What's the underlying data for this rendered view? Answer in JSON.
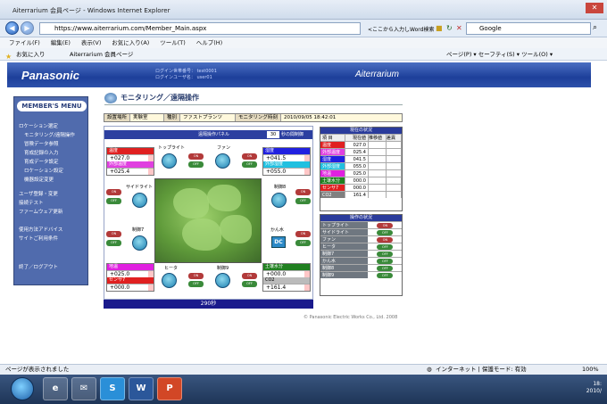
{
  "browser": {
    "title": "Aiterrarium 会員ページ - Windows Internet Explorer",
    "url": "https://www.aiterrarium.com/Member_Main.aspx",
    "search_placeholder": "Google",
    "search_scope": "<ここから入力しWord検索",
    "menus": [
      "ファイル(F)",
      "編集(E)",
      "表示(V)",
      "お気に入り(A)",
      "ツール(T)",
      "ヘルプ(H)"
    ],
    "favorites_label": "お気に入り",
    "tab_label": "Aiterrarium 会員ページ",
    "toolbar_right": "ページ(P) ▾  セーフティ(S) ▾  ツール(O) ▾",
    "status_left": "ページが表示されました",
    "status_zone": "インターネット | 保護モード: 有効",
    "zoom": "100%"
  },
  "site": {
    "brand": "Panasonic",
    "login_line1": "ログイン世帯番号：  test0001",
    "login_line2": "ログインユーザ名：  user01",
    "product_logo": "Aiterrarium"
  },
  "menu": {
    "title": "MEMBER'S MENU",
    "items": [
      "ロケーション選定",
      "モニタリング/遠隔操作",
      "冒険データ参照",
      "育成記録の入力",
      "育成データ設定",
      "ロケーション設定",
      "機器設定変更",
      "ユーザ登録・変更",
      "接続テスト",
      "ファームウェア更新",
      "使用方法アドバイス",
      "サイトご利用条件",
      "終了／ログアウト"
    ]
  },
  "page": {
    "title": "モニタリング／遠隔操作",
    "location_label": "設置場所",
    "location_value": "実験室",
    "type_label": "種別",
    "type_value": "ファストプランツ",
    "time_label": "モニタリング時刻",
    "time_value": "2010/09/05  18:42:01",
    "copyright": "© Panasonic Electric Works Co., Ltd. 2008"
  },
  "panel": {
    "header": "遠隔操作パネル",
    "interval_value": "30",
    "interval_unit": "秒の間制御",
    "timer": "290秒",
    "on_label": "ON",
    "off_label": "OFF",
    "dc_label": "DC",
    "temp": {
      "label": "温度",
      "value": "+027.0"
    },
    "ext_temp": {
      "label": "外部温度",
      "value": "+025.4"
    },
    "humidity": {
      "label": "湿度",
      "value": "+041.5"
    },
    "ext_humidity": {
      "label": "外部湿度",
      "value": "+055.0"
    },
    "soil_temp": {
      "label": "地温",
      "value": "+025.0"
    },
    "sensor": {
      "label": "センサ7",
      "value": "+000.0"
    },
    "soil_water": {
      "label": "土壌水分",
      "value": "+000.0"
    },
    "co2": {
      "label": "CO2",
      "value": "+161.4"
    },
    "devices": {
      "toplight": "トップライト",
      "fan": "ファン",
      "sidelight": "サイドライト",
      "ctrl8": "制御8",
      "ctrl7": "制御7",
      "heater": "ヒータ",
      "ctrl9": "制御9",
      "watering": "かん水"
    }
  },
  "status_table": {
    "title": "現在の状況",
    "columns": [
      "項 目",
      "現在値",
      "推移値",
      "差異"
    ],
    "rows": [
      {
        "name": "温度",
        "value": "027.0",
        "color": "#e02020"
      },
      {
        "name": "外部温度",
        "value": "025.4",
        "color": "#e040e0"
      },
      {
        "name": "湿度",
        "value": "041.5",
        "color": "#2020e0"
      },
      {
        "name": "外部湿度",
        "value": "055.0",
        "color": "#20c0e0"
      },
      {
        "name": "地温",
        "value": "025.0",
        "color": "#e020e0"
      },
      {
        "name": "土壌水分",
        "value": "000.0",
        "color": "#208020"
      },
      {
        "name": "センサ7",
        "value": "000.0",
        "color": "#e02020"
      },
      {
        "name": "CO2",
        "value": "161.4",
        "color": "#808080"
      }
    ]
  },
  "ops_table": {
    "title": "操作の状況",
    "rows": [
      {
        "name": "トップライト",
        "state": "ON"
      },
      {
        "name": "サイドライト",
        "state": "OFF"
      },
      {
        "name": "ファン",
        "state": "ON"
      },
      {
        "name": "ヒータ",
        "state": "OFF"
      },
      {
        "name": "制御7",
        "state": "OFF"
      },
      {
        "name": "かん水",
        "state": "OFF"
      },
      {
        "name": "制御8",
        "state": "OFF"
      },
      {
        "name": "制御9",
        "state": "OFF"
      }
    ]
  },
  "taskbar": {
    "apps": [
      "e",
      "✉",
      "S",
      "W",
      "P"
    ],
    "time": "18:",
    "date": "2010/"
  }
}
